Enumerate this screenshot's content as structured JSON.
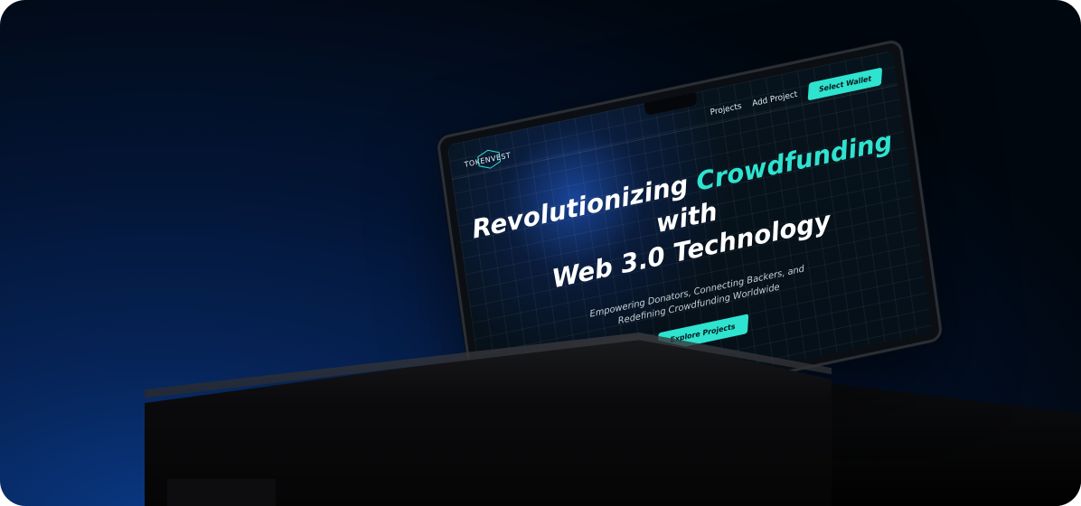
{
  "brand": {
    "logo_text": "TOKENVEST"
  },
  "nav": {
    "links": [
      "Projects",
      "Add Project"
    ],
    "wallet_button": "Select Wallet"
  },
  "hero": {
    "title_part1": "Revolutionizing ",
    "title_accent": "Crowdfunding",
    "title_part2": " with",
    "title_line2": "Web 3.0 Technology",
    "subtitle_line1": "Empowering Donators, Connecting Backers, and",
    "subtitle_line2": "Redefining Crowdfunding Worldwide",
    "cta": "Explore Projects"
  },
  "colors": {
    "accent": "#2ee3cf",
    "background": "#031433",
    "screen": "#07131c"
  }
}
